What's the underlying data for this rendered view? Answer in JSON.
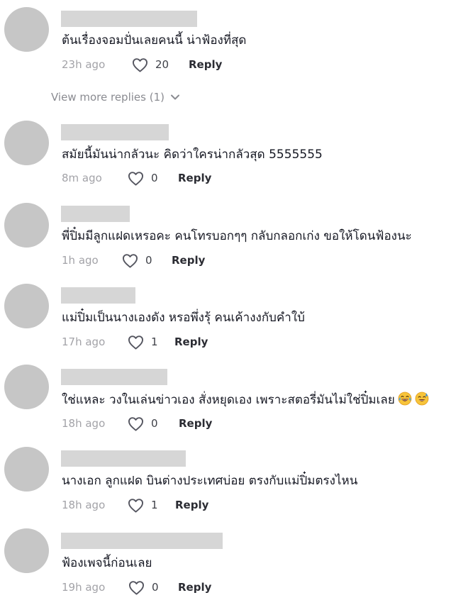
{
  "comments": [
    {
      "text": "ต้นเรื่องจอมปั่นเลยคนนี้ น่าฟ้องที่สุด",
      "time": "23h ago",
      "likes": "20",
      "reply": "Reply"
    },
    {
      "text": "สมัยนี้มันน่ากลัวนะ คิดว่าใครน่ากลัวสุด 5555555",
      "time": "8m ago",
      "likes": "0",
      "reply": "Reply"
    },
    {
      "text": "พี่ปิ๋มมีลูกแฝดเหรอคะ คนโทรบอกๆๆ กลับกลอกเก่ง ขอให้โดนฟ้องนะ",
      "time": "1h ago",
      "likes": "0",
      "reply": "Reply"
    },
    {
      "text": "แม่ปิ๋มเป็นนางเองดัง หรอพึ่งรุ้ คนเค้างงกับคำใบ้",
      "time": "17h ago",
      "likes": "1",
      "reply": "Reply"
    },
    {
      "text": "ใช่แหละ วงในเล่นข่าวเอง สั่งหยุดเอง เพราะสตอรี่มันไม่ใช่ปิ๋มเลย",
      "time": "18h ago",
      "likes": "0",
      "reply": "Reply",
      "emojis": [
        "face-with-tears-of-joy-emoji",
        "sweat-smile-emoji"
      ]
    },
    {
      "text": "นางเอก ลูกแฝด บินต่างประเทศบ่อย ตรงกับแม่ปิ๋มตรงไหน",
      "time": "18h ago",
      "likes": "1",
      "reply": "Reply"
    },
    {
      "text": "ฟ้องเพจนี้ก่อนเลย",
      "time": "19h ago",
      "likes": "0",
      "reply": "Reply"
    }
  ],
  "view_more": {
    "label": "View more replies (1)",
    "icon": "chevron-down-icon"
  },
  "icons": {
    "like": "heart-outline-icon"
  },
  "colors": {
    "avatar": "#c6c6c6",
    "name_placeholder": "#d6d6d6",
    "text": "#161823",
    "muted": "#a3a3a8",
    "view_more": "#8a8b91"
  }
}
